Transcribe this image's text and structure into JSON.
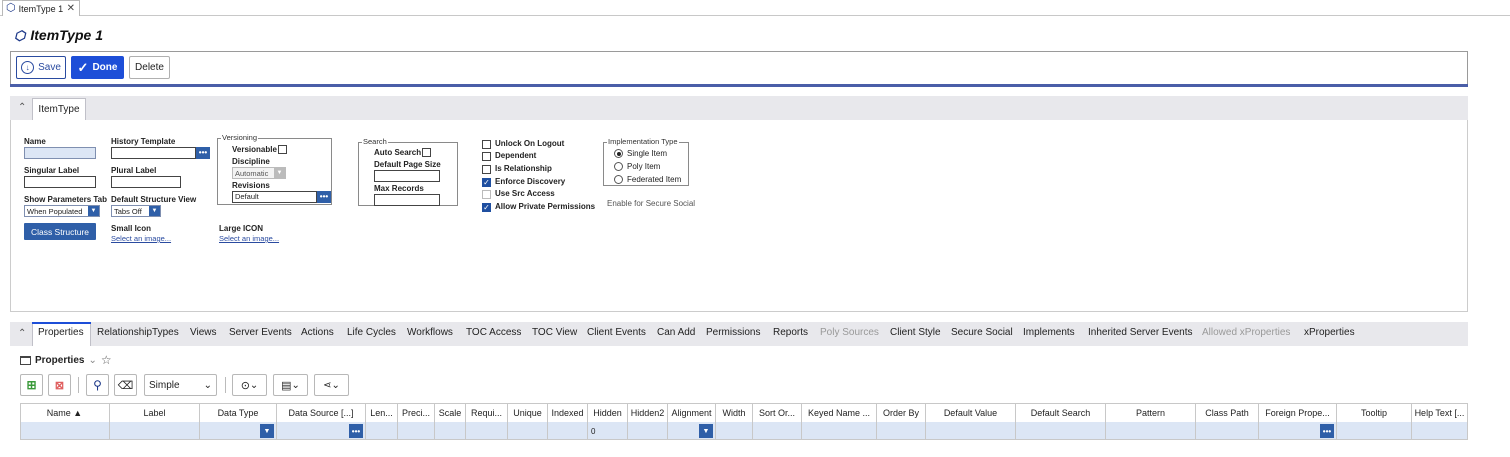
{
  "tab": {
    "title": "ItemType 1"
  },
  "page": {
    "title": "ItemType 1"
  },
  "toolbar": {
    "save": "Save",
    "done": "Done",
    "delete": "Delete"
  },
  "section": {
    "tab": "ItemType"
  },
  "form": {
    "name_label": "Name",
    "name_value": "",
    "singular_label": "Singular Label",
    "show_params_label": "Show Parameters Tab",
    "show_params_value": "When Populated",
    "class_structure": "Class Structure",
    "history_template_label": "History Template",
    "plural_label": "Plural Label",
    "default_structure_label": "Default Structure View",
    "default_structure_value": "Tabs Off",
    "small_icon_label": "Small Icon",
    "small_icon_link": "Select an image...",
    "large_icon_label": "Large ICON",
    "large_icon_link": "Select an image...",
    "versioning": {
      "legend": "Versioning",
      "versionable": "Versionable",
      "discipline_label": "Discipline",
      "discipline_value": "Automatic",
      "revisions_label": "Revisions",
      "revisions_value": "Default"
    },
    "search": {
      "legend": "Search",
      "auto_search": "Auto Search",
      "page_size_label": "Default Page Size",
      "max_records_label": "Max Records"
    },
    "checks": [
      {
        "label": "Unlock On Logout",
        "checked": false,
        "disabled": false
      },
      {
        "label": "Dependent",
        "checked": false,
        "disabled": false
      },
      {
        "label": "Is Relationship",
        "checked": false,
        "disabled": false
      },
      {
        "label": "Enforce Discovery",
        "checked": true,
        "disabled": false
      },
      {
        "label": "Use Src Access",
        "checked": false,
        "disabled": true
      },
      {
        "label": "Allow Private Permissions",
        "checked": true,
        "disabled": false
      }
    ],
    "impl": {
      "legend": "Implementation Type",
      "options": [
        "Single Item",
        "Poly Item",
        "Federated Item"
      ],
      "selected": "Single Item"
    },
    "secure_social": "Enable for Secure Social"
  },
  "rel_tabs": [
    {
      "label": "Properties",
      "disabled": false
    },
    {
      "label": "RelationshipTypes",
      "disabled": false
    },
    {
      "label": "Views",
      "disabled": false
    },
    {
      "label": "Server Events",
      "disabled": false
    },
    {
      "label": "Actions",
      "disabled": false
    },
    {
      "label": "Life Cycles",
      "disabled": false
    },
    {
      "label": "Workflows",
      "disabled": false
    },
    {
      "label": "TOC Access",
      "disabled": false
    },
    {
      "label": "TOC View",
      "disabled": false
    },
    {
      "label": "Client Events",
      "disabled": false
    },
    {
      "label": "Can Add",
      "disabled": false
    },
    {
      "label": "Permissions",
      "disabled": false
    },
    {
      "label": "Reports",
      "disabled": false
    },
    {
      "label": "Poly Sources",
      "disabled": true
    },
    {
      "label": "Client Style",
      "disabled": false
    },
    {
      "label": "Secure Social",
      "disabled": false
    },
    {
      "label": "Implements",
      "disabled": false
    },
    {
      "label": "Inherited Server Events",
      "disabled": false
    },
    {
      "label": "Allowed xProperties",
      "disabled": true
    },
    {
      "label": "xProperties",
      "disabled": false
    }
  ],
  "grid": {
    "title": "Properties",
    "search_mode": "Simple",
    "columns": [
      "Name ▲",
      "Label",
      "Data Type",
      "Data Source [...]",
      "Len...",
      "Preci...",
      "Scale",
      "Requi...",
      "Unique",
      "Indexed",
      "Hidden",
      "Hidden2",
      "Alignment",
      "Width",
      "Sort Or...",
      "Keyed Name ...",
      "Order By",
      "Default Value",
      "Default Search",
      "Pattern",
      "Class Path",
      "Foreign Prope...",
      "Tooltip",
      "Help Text [..."
    ],
    "row_hidden_value": "0"
  }
}
